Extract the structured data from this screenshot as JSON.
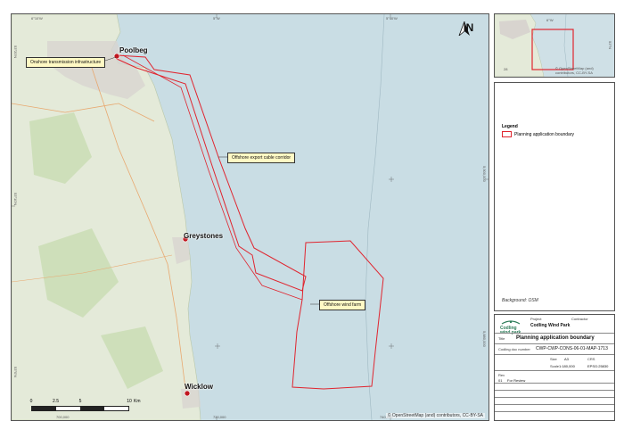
{
  "map": {
    "top_coords": [
      "6°10'W",
      "5°W",
      "5°40'W"
    ],
    "left_coords": [
      "53°20'N",
      "53°10'N",
      "53°0'N"
    ],
    "right_coords": [
      "5,900,000",
      "5,880,000"
    ],
    "bottom_coords": [
      "700,000",
      "720,000",
      "740,000"
    ],
    "places": {
      "poolbeg": "Poolbeg",
      "greystones": "Greystones",
      "wicklow": "Wicklow"
    },
    "callouts": {
      "onshore": "Onshore transmission infrastructure",
      "export_cable": "Offshore export cable corridor",
      "wind_farm": "Offshore wind farm"
    },
    "north_label": "N",
    "scale": {
      "ticks": [
        "0",
        "2.5",
        "5",
        "10"
      ],
      "unit": "Km"
    },
    "attribution": "© OpenStreetMap (and) contributors, CC-BY-SA",
    "colors": {
      "sea": "#c9dde4",
      "land": "#e9eee0",
      "boundary": "#e0252f"
    }
  },
  "inset": {
    "label_lon": "6°W",
    "label_lat": "53°N",
    "label_tick": "28",
    "attribution": "© OpenStreetMap (and) contributors, CC-BY-SA"
  },
  "legend": {
    "title": "Legend",
    "items": [
      {
        "label": "Planning application boundary",
        "color": "#e0252f"
      }
    ],
    "background": "Background: OSM"
  },
  "titleblock": {
    "logo_line1": "Codling",
    "logo_line2": "wind park",
    "project_label": "Project",
    "project_value": "Codling Wind Park",
    "contractor_label": "Contractor",
    "title_label": "Title",
    "title_value": "Planning application boundary",
    "drawing_label": "Codling doc number",
    "drawing_value": "CWP-CWP-CONS-06-01-MAP-1713",
    "size_label": "Size",
    "size_value": "A3",
    "scale_label": "Scale",
    "scale_value": "1:180,000",
    "crs_label": "CRS",
    "crs_value": "EPSG:25830",
    "rev_label": "Rev",
    "rev_value": "01",
    "rev_desc": "For Review"
  }
}
